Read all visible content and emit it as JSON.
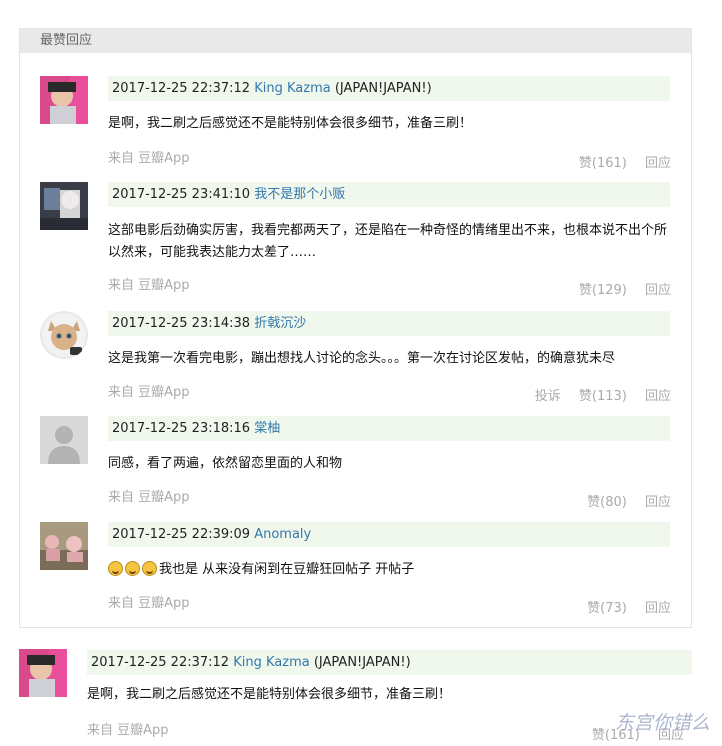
{
  "section_title": "最赞回应",
  "comments": [
    {
      "date": "2017-12-25 22:37:12",
      "author": "King Kazma",
      "location": "(JAPAN!JAPAN!)",
      "text": "是啊，我二刷之后感觉还不是能特别体会很多细节，准备三刷！",
      "source": "来自",
      "app": "豆瓣App",
      "report": "",
      "likes": "赞(161)",
      "reply": "回应"
    },
    {
      "date": "2017-12-25 23:41:10",
      "author": "我不是那个小贩",
      "location": "",
      "text": "这部电影后劲确实厉害，我看完都两天了，还是陷在一种奇怪的情绪里出不来，也根本说不出个所以然来，可能我表达能力太差了……",
      "source": "来自",
      "app": "豆瓣App",
      "report": "",
      "likes": "赞(129)",
      "reply": "回应"
    },
    {
      "date": "2017-12-25 23:14:38",
      "author": "折戟沉沙",
      "location": "",
      "text": "这是我第一次看完电影，蹦出想找人讨论的念头。。。第一次在讨论区发帖，的确意犹未尽",
      "source": "来自",
      "app": "豆瓣App",
      "report": "投诉",
      "likes": "赞(113)",
      "reply": "回应"
    },
    {
      "date": "2017-12-25 23:18:16",
      "author": "棠柚",
      "location": "",
      "text": "同感，看了两遍，依然留恋里面的人和物",
      "source": "来自",
      "app": "豆瓣App",
      "report": "",
      "likes": "赞(80)",
      "reply": "回应"
    },
    {
      "date": "2017-12-25 22:39:09",
      "author": "Anomaly",
      "location": "",
      "text": "我也是 从来没有闲到在豆瓣狂回帖子 开帖子",
      "source": "来自",
      "app": "豆瓣App",
      "report": "",
      "likes": "赞(73)",
      "reply": "回应"
    }
  ],
  "outside_comment": {
    "date": "2017-12-25 22:37:12",
    "author": "King Kazma",
    "location": "(JAPAN!JAPAN!)",
    "text": "是啊，我二刷之后感觉还不是能特别体会很多细节，准备三刷！",
    "source": "来自",
    "app": "豆瓣App",
    "likes": "赞(161)",
    "reply": "回应"
  },
  "watermark": "东宫你错么"
}
